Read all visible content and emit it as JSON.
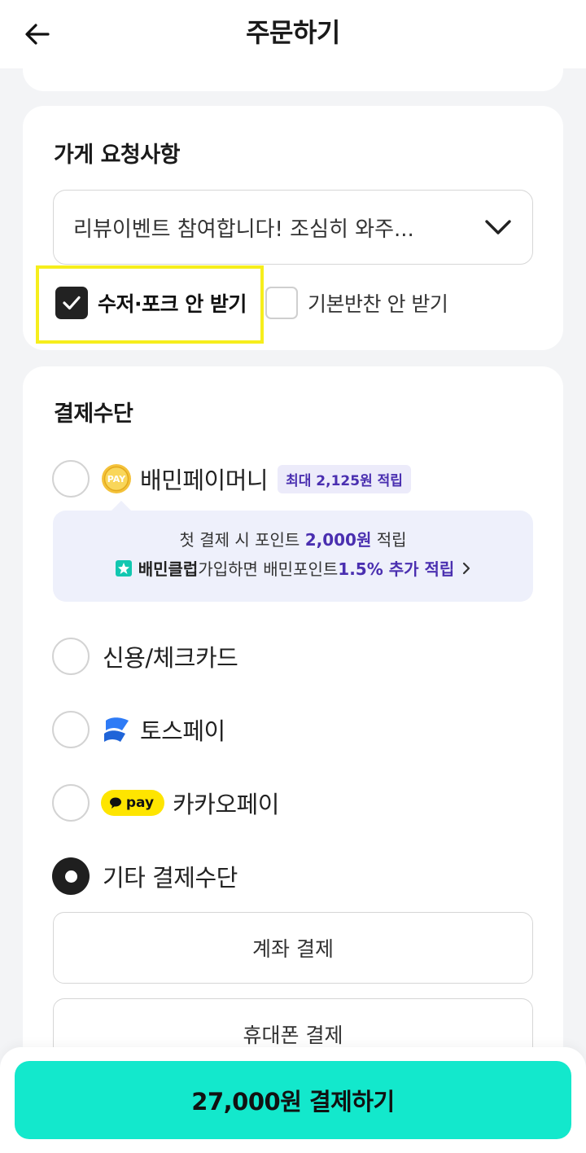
{
  "header": {
    "title": "주문하기"
  },
  "request": {
    "section_title": "가게 요청사항",
    "select_value": "리뷰이벤트 참여합니다! 조심히 와주...",
    "no_utensils_label": "수저·포크 안 받기",
    "no_utensils_checked": true,
    "no_side_dish_label": "기본반찬 안 받기",
    "no_side_dish_checked": false
  },
  "payment": {
    "section_title": "결제수단",
    "baemin_pay": {
      "label": "배민페이머니",
      "badge": "최대 2,125원 적립",
      "icon_text": "PAY"
    },
    "promo": {
      "line1_pre": "첫 결제 시 포인트 ",
      "line1_amount": "2,000원",
      "line1_post": " 적립",
      "line2_club": "배민클럽",
      "line2_mid": " 가입하면 배민포인트 ",
      "line2_rate": "1.5% 추가 적립"
    },
    "card": {
      "label": "신용/체크카드"
    },
    "toss": {
      "label": "토스페이"
    },
    "kakao": {
      "label": "카카오페이",
      "icon_text": "pay"
    },
    "other": {
      "label": "기타 결제수단",
      "selected": true
    },
    "bank_transfer": "계좌 결제",
    "phone_payment": "휴대폰 결제"
  },
  "pay_button": {
    "label": "27,000원 결제하기"
  },
  "colors": {
    "accent": "#13e8cc",
    "purple": "#4a2fb0",
    "highlight": "#f6ee1c",
    "kakao_yellow": "#fee500",
    "toss_blue": "#2e7bf6"
  }
}
